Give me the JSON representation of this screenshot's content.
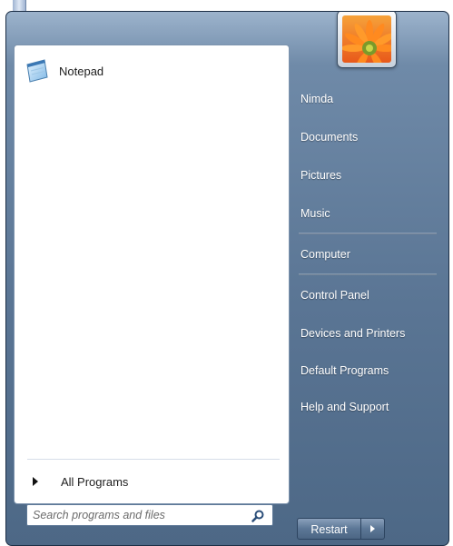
{
  "start_menu": {
    "pinned_programs": [
      {
        "label": "Notepad",
        "icon": "notepad-icon"
      }
    ],
    "all_programs_label": "All Programs",
    "search": {
      "placeholder": "Search programs and files",
      "value": "",
      "icon": "search-icon"
    },
    "user_picture": "flower-icon",
    "right_items": [
      {
        "label": "Nimda"
      },
      {
        "label": "Documents"
      },
      {
        "label": "Pictures"
      },
      {
        "label": "Music"
      },
      {
        "label": "Computer"
      },
      {
        "label": "Control Panel"
      },
      {
        "label": "Devices and Printers"
      },
      {
        "label": "Default Programs"
      },
      {
        "label": "Help and Support"
      }
    ],
    "restart_label": "Restart"
  },
  "colors": {
    "menu_bg": "#5a7594",
    "left_panel_bg": "#ffffff",
    "text_light": "#ffffff",
    "text_dark": "#1e1e1e"
  }
}
